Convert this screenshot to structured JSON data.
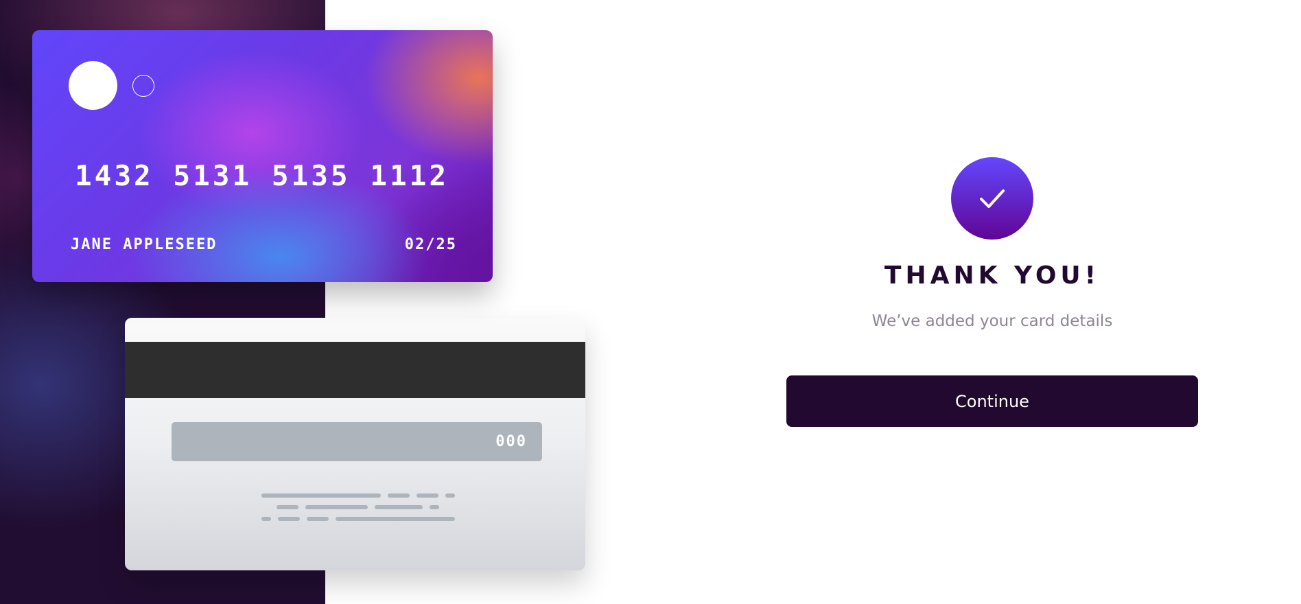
{
  "card": {
    "number": "1432 5131 5135 1112",
    "holder_name": "JANE APPLESEED",
    "expiry": "02/25",
    "cvc": "000"
  },
  "icons": {
    "card_logo_filled": "circle-filled-icon",
    "card_logo_outline": "circle-outline-icon",
    "success": "checkmark-icon"
  },
  "complete": {
    "title": "THANK YOU!",
    "message": "We’ve added your card details",
    "continue_label": "Continue"
  },
  "colors": {
    "panel_background": "#210d31",
    "accent_start": "#6348fe",
    "accent_end": "#610595",
    "dark_violet": "#21092f",
    "grayish_violet": "#8e8593",
    "white": "#ffffff"
  }
}
